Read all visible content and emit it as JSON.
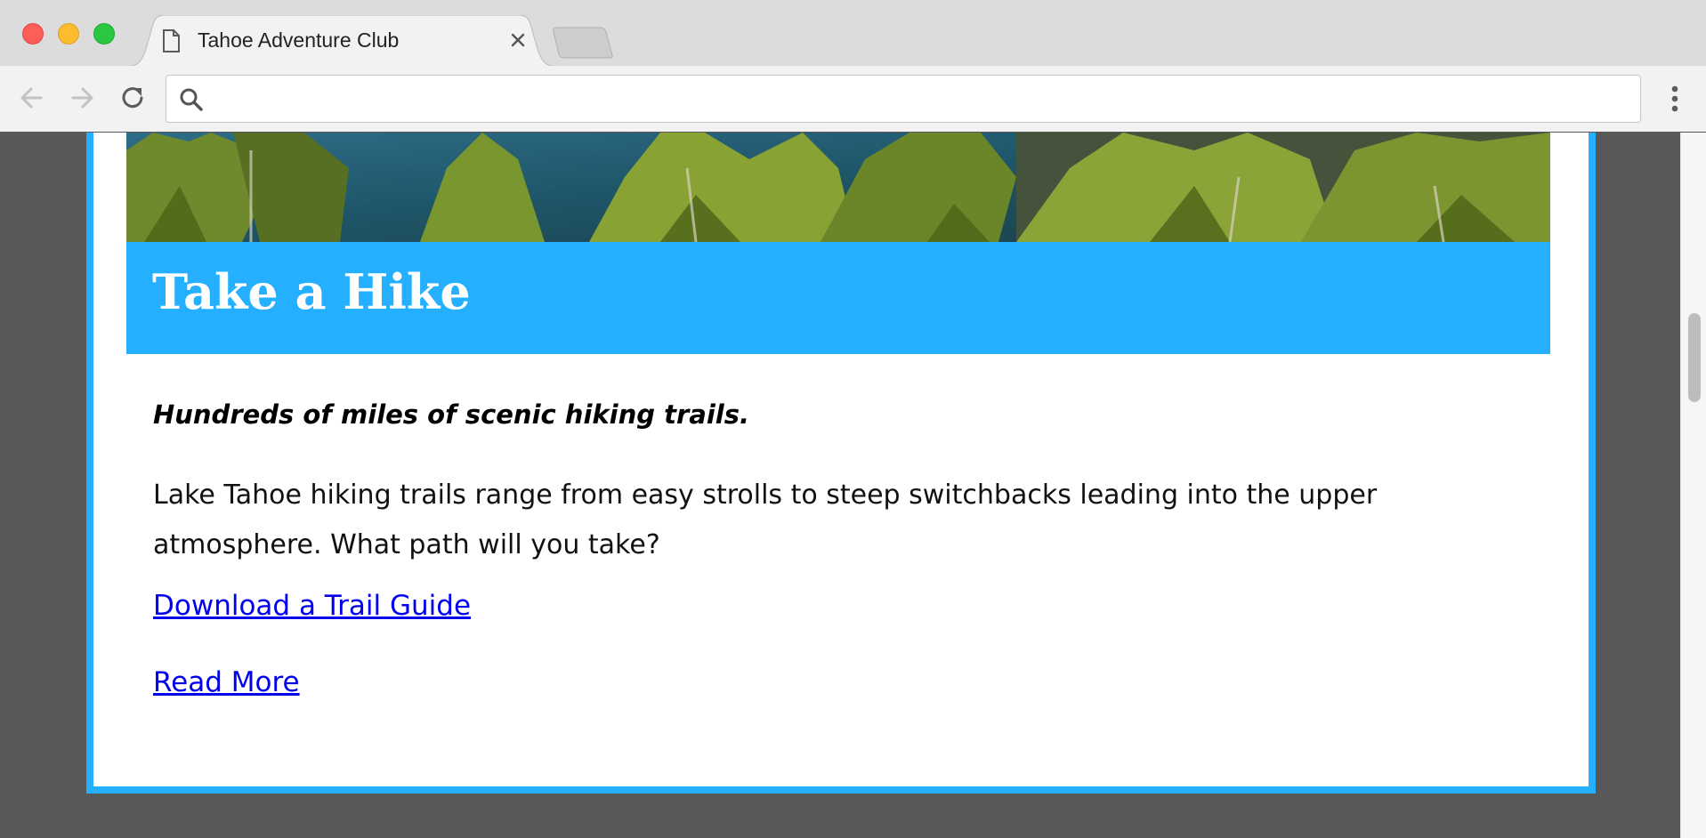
{
  "browser": {
    "tab_title": "Tahoe Adventure Club",
    "address_value": "",
    "address_placeholder": ""
  },
  "page": {
    "banner_title": "Take a Hike",
    "tagline": "Hundreds of miles of scenic hiking trails.",
    "description": "Lake Tahoe hiking trails range from easy strolls to steep switchbacks leading into the upper atmosphere. What path will you take?",
    "links": {
      "trail_guide": "Download a Trail Guide",
      "read_more": "Read More"
    }
  },
  "colors": {
    "accent": "#25b0ff",
    "link": "#0000ee",
    "page_background": "#585858",
    "card_background": "#ffffff"
  },
  "icons": [
    "document-icon",
    "close-icon",
    "back-arrow-icon",
    "forward-arrow-icon",
    "reload-icon",
    "search-icon",
    "more-vertical-icon"
  ]
}
